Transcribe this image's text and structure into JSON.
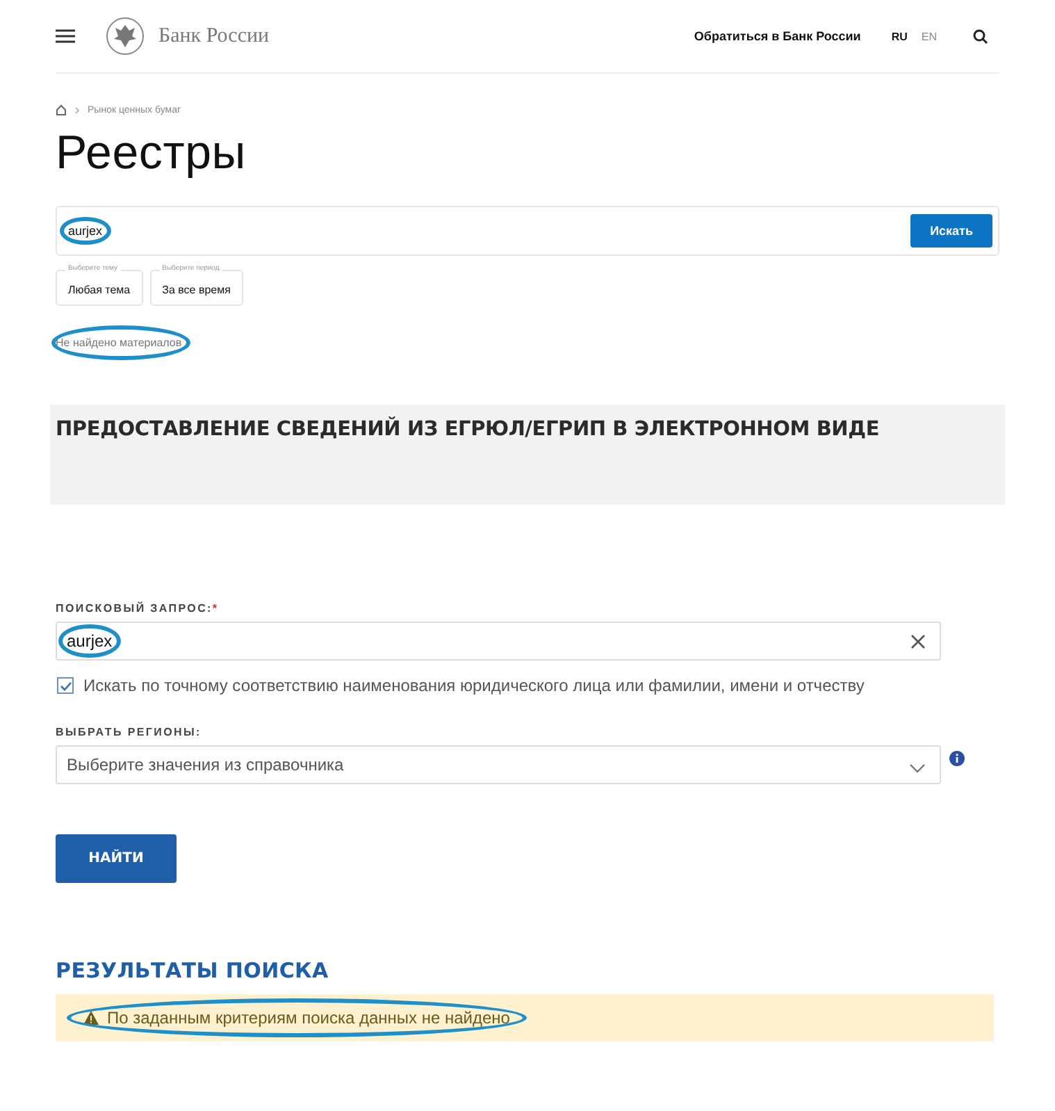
{
  "header": {
    "brand": "Банк России",
    "contact_link": "Обратиться в Банк России",
    "languages": [
      {
        "label": "RU",
        "selected": true
      },
      {
        "label": "EN",
        "selected": false
      }
    ]
  },
  "breadcrumb": [
    "Рынок ценных бумаг"
  ],
  "page_title": "Реестры",
  "site_search": {
    "value": "aurjex",
    "circled": true,
    "button": "Искать",
    "filters": [
      {
        "legend": "Выберите тему",
        "value": "Любая тема"
      },
      {
        "legend": "Выберите период",
        "value": "За все время"
      }
    ],
    "result": {
      "text": "Не найдено материалов",
      "circled": true
    }
  },
  "egrul": {
    "title": "ПРЕДОСТАВЛЕНИЕ СВЕДЕНИЙ ИЗ ЕГРЮЛ/ЕГРИП В ЭЛЕКТРОННОМ ВИДЕ",
    "query_label": "ПОИСКОВЫЙ ЗАПРОС:",
    "required_mark": "*",
    "query_value": "aurjex",
    "query_circled": true,
    "exact_match": {
      "label": "Искать по точному соответствию наименования юридического лица или фамилии, имени и отчеству",
      "checked": true
    },
    "regions_label": "ВЫБРАТЬ РЕГИОНЫ:",
    "regions_placeholder": "Выберите значения из справочника",
    "find_button": "НАЙТИ",
    "results_title": "РЕЗУЛЬТАТЫ ПОИСКА",
    "results_message": {
      "text": "По заданным критериям поиска данных не найдено",
      "circled": true
    }
  }
}
